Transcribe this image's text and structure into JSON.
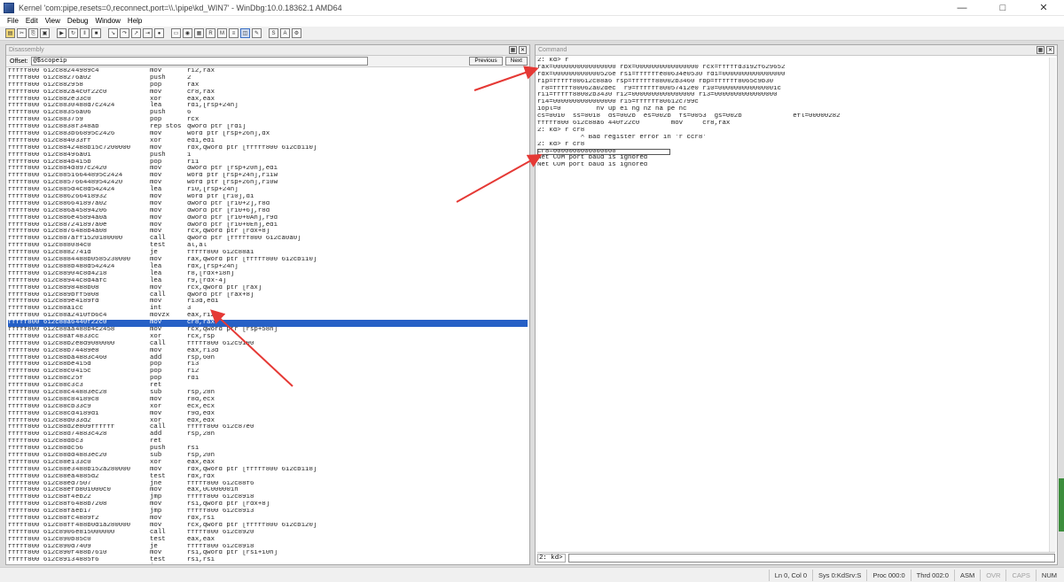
{
  "window": {
    "title": "Kernel 'com:pipe,resets=0,reconnect,port=\\\\.\\pipe\\kd_WIN7' - WinDbg:10.0.18362.1 AMD64"
  },
  "menu": [
    "File",
    "Edit",
    "View",
    "Debug",
    "Window",
    "Help"
  ],
  "toolbar": {
    "icons": [
      "open-icon",
      "cut-icon",
      "copy-icon",
      "paste-icon",
      "go-icon",
      "restart-icon",
      "break-icon",
      "stop-icon",
      "step-into-icon",
      "step-over-icon",
      "step-out-icon",
      "run-to-cursor-icon",
      "breakpoint-icon",
      "command-window-icon",
      "watch-icon",
      "locals-icon",
      "registers-icon",
      "memory-icon",
      "call-stack-icon",
      "disassembly-icon",
      "scratch-pad-icon",
      "source-mode-icon",
      "font-icon",
      "options-icon"
    ]
  },
  "disassembly": {
    "title": "Disassembly",
    "offset_label": "Offset:",
    "offset_value": "@$scopeip",
    "previous_label": "Previous",
    "next_label": "Next",
    "lines": [
      [
        "fffff800`612c8824",
        "4989c4",
        "mov",
        "r12,rax"
      ],
      [
        "fffff800`612c8827",
        "6a02",
        "push",
        "2"
      ],
      [
        "fffff800`612c8829",
        "58",
        "pop",
        "rax"
      ],
      [
        "fffff800`612c882a",
        "4c0f22c0",
        "mov",
        "cr8,rax"
      ],
      [
        "fffff800`612c882e",
        "33c0",
        "xor",
        "eax,eax"
      ],
      [
        "fffff800`612c8830",
        "488d7c2424",
        "lea",
        "rdi,[rsp+24h]"
      ],
      [
        "fffff800`612c8835",
        "6a06",
        "push",
        "6"
      ],
      [
        "fffff800`612c8837",
        "59",
        "pop",
        "rcx"
      ],
      [
        "fffff800`612c8838",
        "f348ab",
        "rep stos",
        "qword ptr [rdi]"
      ],
      [
        "fffff800`612c883b",
        "66895c2426",
        "mov",
        "word ptr [rsp+26h],dx"
      ],
      [
        "fffff800`612c8840",
        "33ff",
        "xor",
        "edi,edi"
      ],
      [
        "fffff800`612c8842",
        "488b15c7200000",
        "mov",
        "rdx,qword ptr [fffff800`612cb110]"
      ],
      [
        "fffff800`612c8849",
        "6a01",
        "push",
        "1"
      ],
      [
        "fffff800`612c884b",
        "415b",
        "pop",
        "r11"
      ],
      [
        "fffff800`612c884d",
        "897c2420",
        "mov",
        "dword ptr [rsp+20h],edi"
      ],
      [
        "fffff800`612c8851",
        "6644895c2424",
        "mov",
        "word ptr [rsp+24h],r11w"
      ],
      [
        "fffff800`612c8857",
        "664489542420",
        "mov",
        "word ptr [rsp+26h],r10w"
      ],
      [
        "fffff800`612c885d",
        "4c8d542424",
        "lea",
        "r10,[rsp+24h]"
      ],
      [
        "fffff800`612c8862",
        "66418932",
        "mov",
        "word ptr [r10],di"
      ],
      [
        "fffff800`612c8866",
        "41897a02",
        "mov",
        "dword ptr [r10+2],r8d"
      ],
      [
        "fffff800`612c886a",
        "45894206",
        "mov",
        "dword ptr [r10+6],r8d"
      ],
      [
        "fffff800`612c886e",
        "45894a0a",
        "mov",
        "dword ptr [r10+0Ah],r9d"
      ],
      [
        "fffff800`612c8872",
        "41897a0e",
        "mov",
        "dword ptr [r10+0Eh],edi"
      ],
      [
        "fffff800`612c8876",
        "488b4a08",
        "mov",
        "rcx,qword ptr [rdx+8]"
      ],
      [
        "fffff800`612c887a",
        "ff1520180000",
        "call",
        "qword ptr [fffff800`612ca0a0]"
      ],
      [
        "fffff800`612c8880",
        "84c0",
        "test",
        "al,al"
      ],
      [
        "fffff800`612c8882",
        "741d",
        "je",
        "fffff800`612c88a1"
      ],
      [
        "fffff800`612c8884",
        "488b0585230000",
        "mov",
        "rax,qword ptr [fffff800`612cb110]"
      ],
      [
        "fffff800`612c888b",
        "488d542424",
        "lea",
        "rdx,[rsp+24h]"
      ],
      [
        "fffff800`612c8890",
        "4c8d4218",
        "lea",
        "r8,[rdx+18h]"
      ],
      [
        "fffff800`612c8894",
        "4c8d4afc",
        "lea",
        "r9,[rdx-4]"
      ],
      [
        "fffff800`612c8898",
        "488b08",
        "mov",
        "rcx,qword ptr [rax]"
      ],
      [
        "fffff800`612c889b",
        "ff5008",
        "call",
        "qword ptr [rax+8]"
      ],
      [
        "fffff800`612c889e",
        "4189fd",
        "mov",
        "r13d,edi"
      ],
      [
        "fffff800`612c88a1",
        "cc",
        "int",
        "3"
      ],
      [
        "fffff800`612c88a2",
        "410fb6c4",
        "movzx",
        "eax,r12b"
      ],
      [
        "fffff800`612c88a6",
        "440f22c0",
        "mov",
        "cr8,rax"
      ],
      [
        "fffff800`612c88aa",
        "488b4c2458",
        "mov",
        "rcx,qword ptr [rsp+58h]"
      ],
      [
        "fffff800`612c88af",
        "4833cc",
        "xor",
        "rcx,rsp"
      ],
      [
        "fffff800`612c88b2",
        "e8d9080000",
        "call",
        "fffff800`612c9190"
      ],
      [
        "fffff800`612c88b7",
        "4489e8",
        "mov",
        "eax,r13d"
      ],
      [
        "fffff800`612c88ba",
        "4883c460",
        "add",
        "rsp,60h"
      ],
      [
        "fffff800`612c88be",
        "415d",
        "pop",
        "r13"
      ],
      [
        "fffff800`612c88c0",
        "415c",
        "pop",
        "r12"
      ],
      [
        "fffff800`612c88c2",
        "5f",
        "pop",
        "rdi"
      ],
      [
        "fffff800`612c88c3",
        "c3",
        "ret",
        ""
      ],
      [
        "fffff800`612c88c4",
        "4883ec28",
        "sub",
        "rsp,28h"
      ],
      [
        "fffff800`612c88c8",
        "4189c8",
        "mov",
        "r8d,ecx"
      ],
      [
        "fffff800`612c88cb",
        "33c9",
        "xor",
        "ecx,ecx"
      ],
      [
        "fffff800`612c88cd",
        "4189d1",
        "mov",
        "r9d,edx"
      ],
      [
        "fffff800`612c88d0",
        "33d2",
        "xor",
        "edx,edx"
      ],
      [
        "fffff800`612c88d2",
        "e809ffffff",
        "call",
        "fffff800`612c87e0"
      ],
      [
        "fffff800`612c88d7",
        "4883c428",
        "add",
        "rsp,28h"
      ],
      [
        "fffff800`612c88db",
        "c3",
        "ret",
        ""
      ],
      [
        "fffff800`612c88dc",
        "56",
        "push",
        "rsi"
      ],
      [
        "fffff800`612c88dd",
        "4883ec20",
        "sub",
        "rsp,20h"
      ],
      [
        "fffff800`612c88e1",
        "33c0",
        "xor",
        "eax,eax"
      ],
      [
        "fffff800`612c88e3",
        "488b152a280000",
        "mov",
        "rdx,qword ptr [fffff800`612cb118]"
      ],
      [
        "fffff800`612c88ea",
        "4885d2",
        "test",
        "rdx,rdx"
      ],
      [
        "fffff800`612c88ed",
        "7507",
        "jne",
        "fffff800`612c88f6"
      ],
      [
        "fffff800`612c88ef",
        "b801000c0",
        "mov",
        "eax,0C000001h"
      ],
      [
        "fffff800`612c88f4",
        "eb22",
        "jmp",
        "fffff800`612c8918"
      ],
      [
        "fffff800`612c88f6",
        "488b7208",
        "mov",
        "rsi,qword ptr [rdx+8]"
      ],
      [
        "fffff800`612c88fa",
        "eb17",
        "jmp",
        "fffff800`612c8913"
      ],
      [
        "fffff800`612c88fc",
        "4889f2",
        "mov",
        "rdx,rsi"
      ],
      [
        "fffff800`612c88ff",
        "488b0d1a280000",
        "mov",
        "rcx,qword ptr [fffff800`612cb120]"
      ],
      [
        "fffff800`612c8906",
        "e815000000",
        "call",
        "fffff800`612c8920"
      ],
      [
        "fffff800`612c890b",
        "85c0",
        "test",
        "eax,eax"
      ],
      [
        "fffff800`612c890d",
        "7409",
        "je",
        "fffff800`612c8918"
      ],
      [
        "fffff800`612c890f",
        "488b7610",
        "mov",
        "rsi,qword ptr [rsi+10h]"
      ],
      [
        "fffff800`612c8913",
        "4885f6",
        "test",
        "rsi,rsi"
      ],
      [
        "fffff800`612c8916",
        "75e4",
        "jne",
        "fffff800`612c88fc"
      ],
      [
        "fffff800`612c8918",
        "4883c420",
        "add",
        "rsp,20h"
      ]
    ]
  },
  "command": {
    "title": "Command",
    "lines": [
      "2: kd> r",
      "rax=0000000000000000 rbx=0000000000000000 rcx=fffffd3192f629652",
      "rdx=000000000000526e rsi=ffffffe80634e0530 rdi=0000000000000000",
      "rip=fffff80612c88a6 rsp=ffffff88002b3460 rbp=ffffff8065c9b30",
      " r8=fffff80062a02dec  r9=ffffff80057412e0 r10=000000000000001c",
      "r11=fffff88002b3430 r12=0000000000000000 r13=0000000000000000",
      "r14=0000000000000000 r15=ffffff80612c799c",
      "iopl=0         nv up ei ng nz na pe nc",
      "cs=0010  ss=0018  ds=002b  es=002b  fs=0053  gs=002b             efl=00000282",
      "fffff800`612c88a6 440f22c0        mov     cr8,rax",
      "2: kd> r cr8",
      "           ^ Bad register error in 'r ccr8'",
      "2: kd> r cr8",
      "cr8=0000000000000000",
      "Net COM port baud is ignored",
      "Net COM port baud is ignored"
    ],
    "boxed_line_index": 13,
    "prompt": "2: kd>",
    "input_value": ""
  },
  "status": {
    "lncol": "Ln 0, Col 0",
    "sys": "Sys 0:KdSrv:S",
    "proc": "Proc 000:0",
    "thrd": "Thrd 002:0",
    "asm": "ASM",
    "ovr": "OVR",
    "caps": "CAPS",
    "num": "NUM"
  },
  "colors": {
    "accent": "#2660c6",
    "annotation_arrow": "#e53935"
  }
}
